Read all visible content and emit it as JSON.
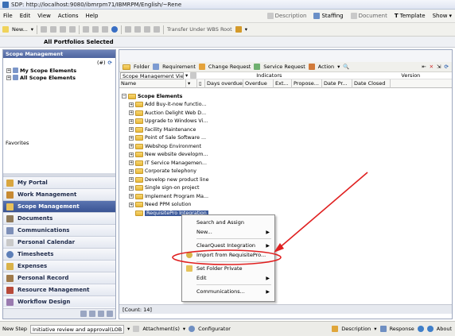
{
  "window": {
    "title": "SDP: http://localhost:9080/ibmrpm71/IBMRPM/English/~Rene"
  },
  "menu": [
    "File",
    "Edit",
    "View",
    "Actions",
    "Help"
  ],
  "menu_tools": [
    "Description",
    "Staffing",
    "Document",
    "Template",
    "Show"
  ],
  "toolbar": {
    "new_label": "New...",
    "wbs_label": "Transfer Under WBS Root"
  },
  "portfolio_label": "All Portfolios Selected",
  "left": {
    "header": "Scope Management",
    "counter": "(#)",
    "items": [
      "My Scope Elements",
      "All Scope Elements"
    ],
    "favorites": "Favorites",
    "nav": [
      "My Portal",
      "Work Management",
      "Scope Management",
      "Documents",
      "Communications",
      "Personal Calendar",
      "Timesheets",
      "Expenses",
      "Personal Record",
      "Resource Management",
      "Workflow Design"
    ]
  },
  "right": {
    "tools": [
      "Folder",
      "Requirement",
      "Change Request",
      "Service Request",
      "Action"
    ],
    "view_select": "Scope Management View",
    "group_indicators": "Indicators",
    "group_version": "Version",
    "columns": [
      "Name",
      "Days overdue",
      "Overdue",
      "Ext...",
      "Propose...",
      "Date Pr...",
      "Date Closed"
    ],
    "root": "Scope Elements",
    "rows": [
      "Add Buy-it-now functio...",
      "Auction Delight Web D...",
      "Upgrade to Windows Vi...",
      "Facility Maintenance",
      "Point of Sale Software ...",
      "Webshop Environment",
      "New website developm...",
      "IT Service Managemen...",
      "Corporate telephony",
      "Develop new product line",
      "Single sign-on project",
      "Implement Program Ma...",
      "Need PPM solution",
      "RequisitePro Integration"
    ],
    "count": "[Count: 14]"
  },
  "context_menu": [
    "Search and Assign",
    "New...",
    "ClearQuest Integration",
    "Import from RequisitePro...",
    "Set Folder Private",
    "Edit",
    "Communications..."
  ],
  "status": {
    "step_label": "New Step",
    "step_value": "Initiative review and approval(LOB Approval)",
    "attachments": "Attachment(s)",
    "configurator": "Configurator",
    "description": "Description",
    "response": "Response",
    "about": "About"
  },
  "colors": {
    "annotation": "#e02020",
    "selection": "#3c5a9b",
    "nav_selected": "#3a5494"
  }
}
